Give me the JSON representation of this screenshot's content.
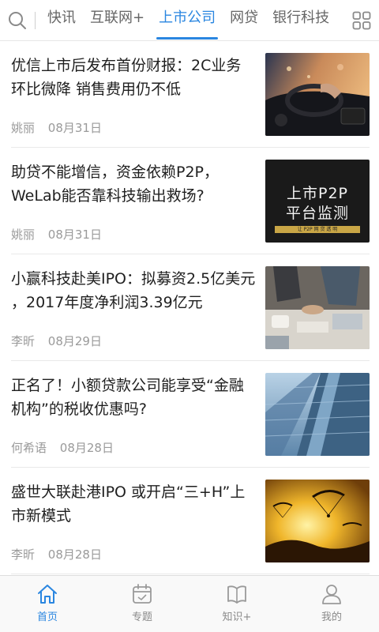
{
  "header": {
    "tabs": [
      {
        "label": "快讯",
        "active": false
      },
      {
        "label": "互联网+",
        "active": false
      },
      {
        "label": "上市公司",
        "active": true
      },
      {
        "label": "网贷",
        "active": false
      },
      {
        "label": "银行科技",
        "active": false
      }
    ],
    "search_icon": "search-icon",
    "menu_icon": "grid-icon"
  },
  "articles": [
    {
      "title": "优信上市后发布首份财报：2C业务环比微降 销售费用仍不低",
      "author": "姚丽",
      "date": "08月31日",
      "thumbnail": "car-interior"
    },
    {
      "title": "助贷不能增信，资金依赖P2P，WeLab能否靠科技输出救场?",
      "author": "姚丽",
      "date": "08月31日",
      "thumbnail": "p2p-monitor-graphic",
      "thumb_text": {
        "line1": "上市P2P",
        "line2": "平台监测",
        "strip": "让 P2P 网 贷 透 明"
      }
    },
    {
      "title": "小赢科技赴美IPO：拟募资2.5亿美元 ，2017年度净利润3.39亿元",
      "author": "李昕",
      "date": "08月29日",
      "thumbnail": "office-meeting"
    },
    {
      "title": "正名了！小额贷款公司能享受“金融机构”的税收优惠吗?",
      "author": "何希语",
      "date": "08月28日",
      "thumbnail": "skyscraper"
    },
    {
      "title": "盛世大联赴港IPO 或开启“三+H”上市新模式",
      "author": "李昕",
      "date": "08月28日",
      "thumbnail": "paragliders-sunset"
    }
  ],
  "bottom_nav": [
    {
      "label": "首页",
      "icon": "home-icon",
      "active": true
    },
    {
      "label": "专题",
      "icon": "calendar-icon",
      "active": false
    },
    {
      "label": "知识+",
      "icon": "book-icon",
      "active": false
    },
    {
      "label": "我的",
      "icon": "user-icon",
      "active": false
    }
  ],
  "colors": {
    "accent": "#2a86e0",
    "text": "#1f1f1f",
    "meta": "#9a9a9a"
  }
}
